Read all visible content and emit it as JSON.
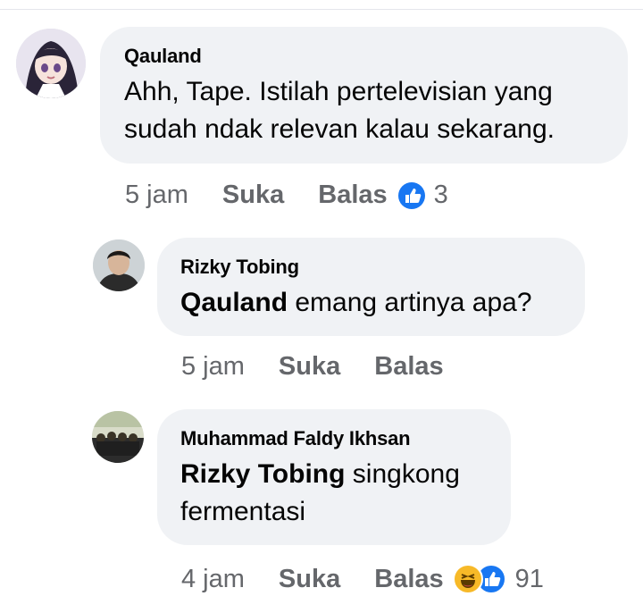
{
  "comments": [
    {
      "author": "Qauland",
      "text_lines": [
        "Ahh, Tape. Istilah pertelevisian yang",
        "sudah ndak relevan kalau sekarang."
      ],
      "time": "5 jam",
      "like_label": "Suka",
      "reply_label": "Balas",
      "reaction_count": "3",
      "reactions": [
        "like-icon"
      ]
    },
    {
      "author": "Rizky Tobing",
      "mention": "Qauland",
      "text": "emang artinya apa?",
      "time": "5 jam",
      "like_label": "Suka",
      "reply_label": "Balas"
    },
    {
      "author": "Muhammad Faldy Ikhsan",
      "mention": "Rizky Tobing",
      "text_line1": "singkong",
      "text_line2": "fermentasi",
      "time": "4 jam",
      "like_label": "Suka",
      "reply_label": "Balas",
      "reaction_count": "91",
      "reactions": [
        "haha-icon",
        "like-icon"
      ]
    }
  ],
  "colors": {
    "bubble": "#f0f2f5",
    "like_blue": "#1877f2",
    "meta_gray": "#65676b",
    "haha_yellow": "#f7b928"
  }
}
